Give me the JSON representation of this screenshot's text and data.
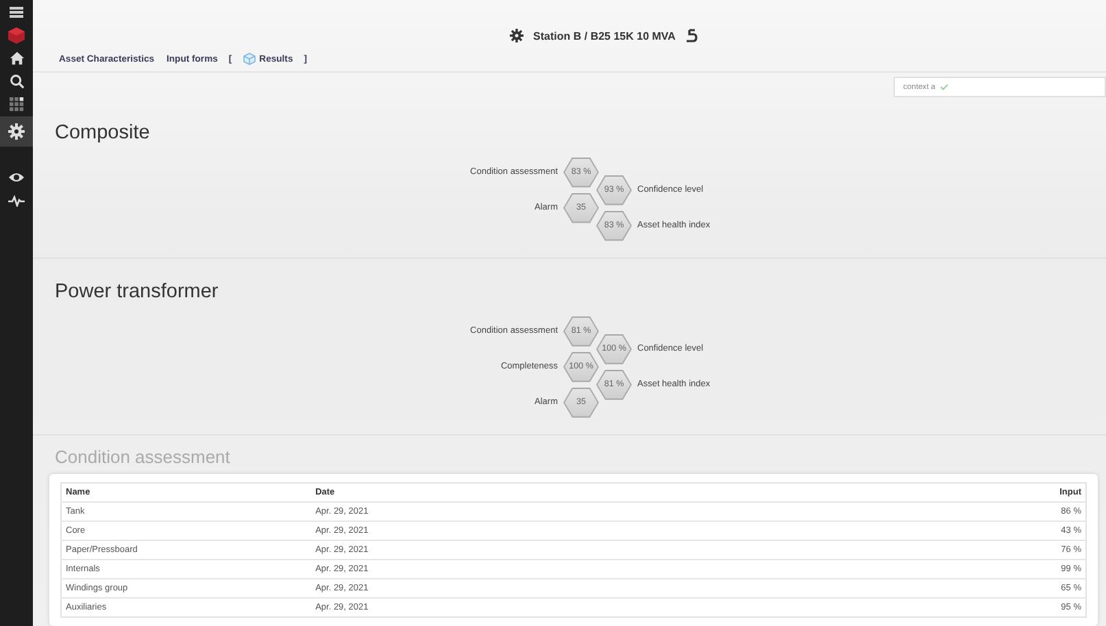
{
  "sidebar": {
    "items": [
      {
        "kind": "menu",
        "selected": false
      },
      {
        "kind": "logo",
        "selected": false
      },
      {
        "kind": "home",
        "selected": false
      },
      {
        "kind": "search",
        "selected": false
      },
      {
        "kind": "grid",
        "selected": false
      },
      {
        "kind": "settings",
        "selected": true
      },
      {
        "kind": "eye",
        "selected": false
      },
      {
        "kind": "pulse",
        "selected": false
      }
    ]
  },
  "header": {
    "title": "Station B / B25 15K 10 MVA",
    "tabs": [
      {
        "label": "Asset Characteristics",
        "selected": false
      },
      {
        "label": "Input forms",
        "selected": false
      },
      {
        "label": "Results",
        "selected": true
      }
    ],
    "brackets": [
      "[",
      "]"
    ],
    "context_field": {
      "value": "context a"
    }
  },
  "sections": [
    {
      "title": "Composite",
      "metrics": [
        {
          "label": "Condition assessment",
          "value": "83 %",
          "kind": "left"
        },
        {
          "label": "Confidence level",
          "value": "93 %",
          "kind": "right"
        },
        {
          "label": "Alarm",
          "value": "35",
          "kind": "left"
        },
        {
          "label": "Asset health index",
          "value": "83 %",
          "kind": "right"
        }
      ]
    },
    {
      "title": "Power transformer",
      "metrics": [
        {
          "label": "Condition assessment",
          "value": "81 %",
          "kind": "left"
        },
        {
          "label": "Confidence level",
          "value": "100 %",
          "kind": "right"
        },
        {
          "label": "Completeness",
          "value": "100 %",
          "kind": "left"
        },
        {
          "label": "Asset health index",
          "value": "81 %",
          "kind": "right"
        },
        {
          "label": "Alarm",
          "value": "35",
          "kind": "left"
        }
      ]
    }
  ],
  "condition_assessment": {
    "title": "Condition assessment",
    "table": {
      "columns": [
        "Name",
        "Date",
        "Input"
      ],
      "rows": [
        [
          "Tank",
          "Apr. 29, 2021",
          "86 %"
        ],
        [
          "Core",
          "Apr. 29, 2021",
          "43 %"
        ],
        [
          "Paper/Pressboard",
          "Apr. 29, 2021",
          "76 %"
        ],
        [
          "Internals",
          "Apr. 29, 2021",
          "99 %"
        ],
        [
          "Windings group",
          "Apr. 29, 2021",
          "65 %"
        ],
        [
          "Auxiliaries",
          "Apr. 29, 2021",
          "95 %"
        ]
      ]
    }
  }
}
